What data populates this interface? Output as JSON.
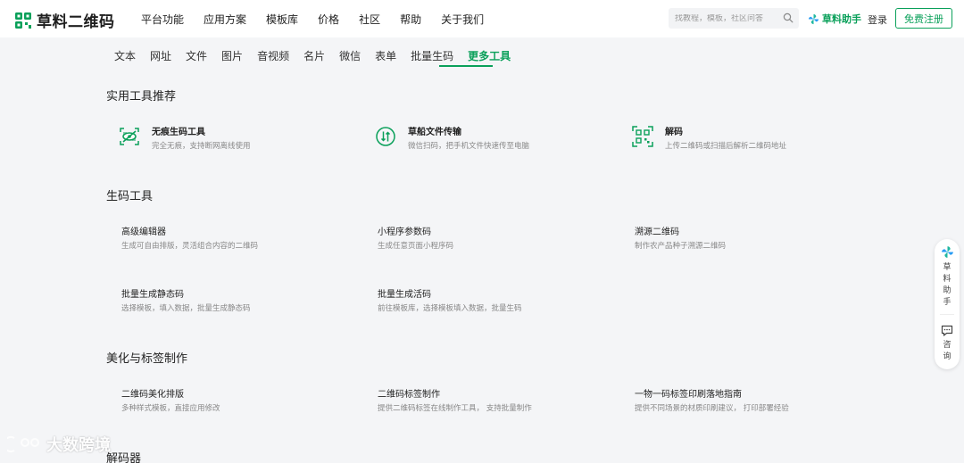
{
  "header": {
    "logo_text": "草料二维码",
    "nav": [
      "平台功能",
      "应用方案",
      "模板库",
      "价格",
      "社区",
      "帮助",
      "关于我们"
    ],
    "search_placeholder": "找教程，模板，社区问答",
    "assistant_label": "草料助手",
    "login_label": "登录",
    "register_label": "免费注册"
  },
  "tabs": {
    "items": [
      "文本",
      "网址",
      "文件",
      "图片",
      "音视频",
      "名片",
      "微信",
      "表单",
      "批量生码",
      "更多工具"
    ],
    "active": "更多工具"
  },
  "sections": {
    "recommended": {
      "title": "实用工具推荐",
      "cards": [
        {
          "title": "无痕生码工具",
          "desc": "完全无痕，支持断网离线使用",
          "icon": "eye-off-qr-icon"
        },
        {
          "title": "草船文件传输",
          "desc": "微信扫码，把手机文件快速传至电脑",
          "icon": "transfer-arrows-icon"
        },
        {
          "title": "解码",
          "desc": "上传二维码或扫描后解析二维码地址",
          "icon": "qr-scan-icon"
        }
      ]
    },
    "generate": {
      "title": "生码工具",
      "cards": [
        {
          "title": "高级编辑器",
          "desc": "生成可自由排版，灵活组合内容的二维码"
        },
        {
          "title": "小程序参数码",
          "desc": "生成任意页面小程序码"
        },
        {
          "title": "溯源二维码",
          "desc": "制作农产品种子溯源二维码"
        },
        {
          "title": "批量生成静态码",
          "desc": "选择模板，填入数据，批量生成静态码"
        },
        {
          "title": "批量生成活码",
          "desc": "前往模板库，选择模板填入数据，批量生码"
        }
      ]
    },
    "beautify": {
      "title": "美化与标签制作",
      "cards": [
        {
          "title": "二维码美化排版",
          "desc": "多种样式模板，直接应用修改"
        },
        {
          "title": "二维码标签制作",
          "desc": "提供二维码标签在线制作工具， 支持批量制作"
        },
        {
          "title": "一物一码标签印刷落地指南",
          "desc": "提供不同场景的材质印刷建议， 打印部署经验"
        }
      ]
    },
    "decoder": {
      "title": "解码器"
    }
  },
  "side_float": {
    "assistant_label": "草料助手",
    "consult_label": "咨询"
  },
  "watermark": "大数跨境",
  "colors": {
    "accent": "#0aa05a",
    "background": "#f4f5f7"
  }
}
